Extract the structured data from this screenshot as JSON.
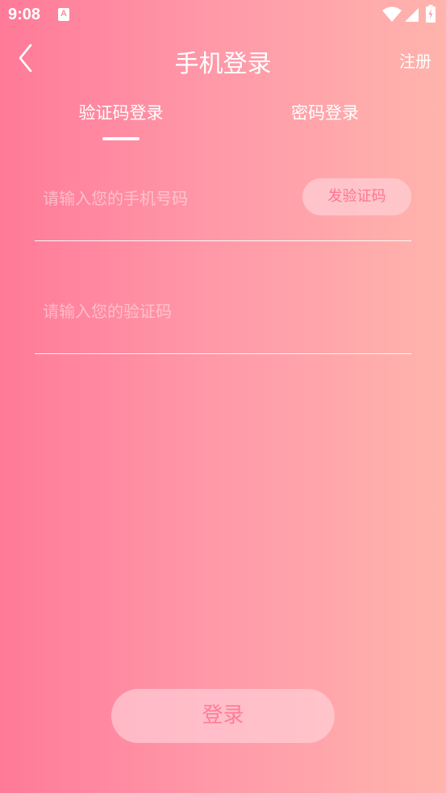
{
  "status_bar": {
    "time": "9:08"
  },
  "header": {
    "title": "手机登录",
    "register_label": "注册"
  },
  "tabs": [
    {
      "label": "验证码登录",
      "active": true
    },
    {
      "label": "密码登录",
      "active": false
    }
  ],
  "phone_input": {
    "value": "",
    "placeholder": "请输入您的手机号码"
  },
  "send_code_label": "发验证码",
  "code_input": {
    "value": "",
    "placeholder": "请输入您的验证码"
  },
  "login_label": "登录",
  "colors": {
    "gradient_start": "#ff7a98",
    "gradient_end": "#ffb4ad",
    "accent_text": "#ff7590"
  }
}
